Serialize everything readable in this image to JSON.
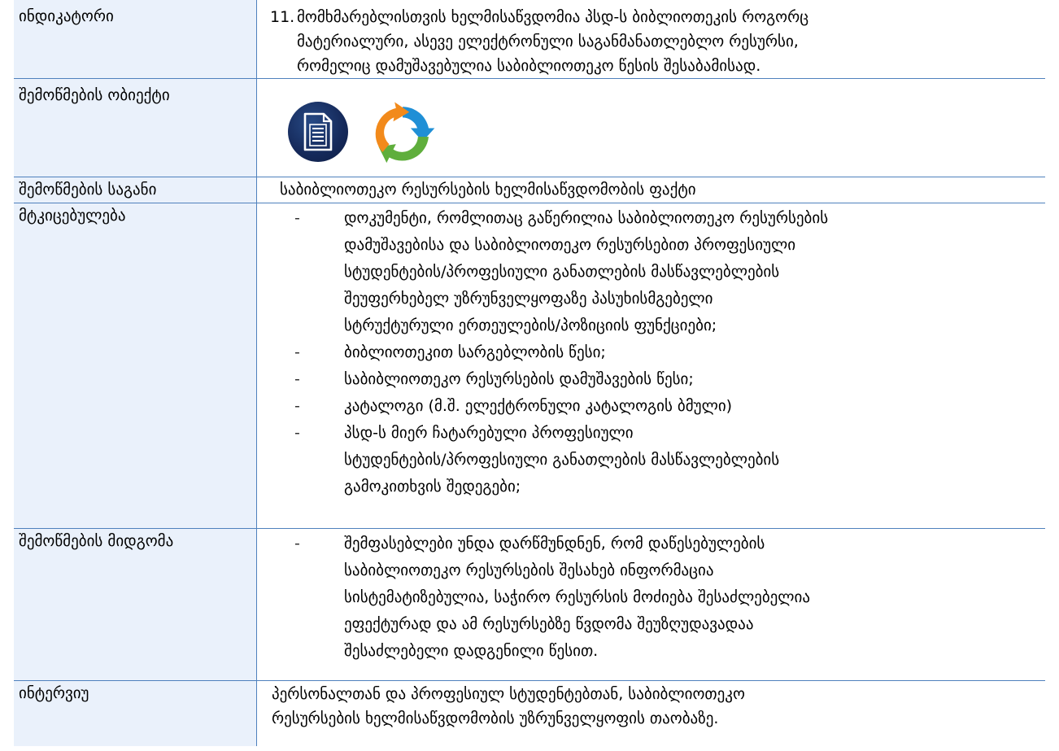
{
  "rows": {
    "indicator": {
      "label": "ინდიკატორი",
      "number": "11.",
      "lines": [
        "მომხმარებლისთვის ხელმისაწვდომია პსდ-ს ბიბლიოთეკის როგორც",
        "მატერიალური, ასევე ელექტრონული საგანმანათლებლო რესურსი,",
        "რომელიც დამუშავებულია საბიბლიოთეკო წესის შესაბამისად."
      ]
    },
    "object": {
      "label": "შემოწმების ობიექტი",
      "icons": [
        "document-icon",
        "refresh-cycle-icon"
      ],
      "colors": {
        "doc_circle": "#15295a",
        "cycle_blue": "#1f8fd6",
        "cycle_orange": "#f28a1b",
        "cycle_green": "#5fae3c"
      }
    },
    "subject": {
      "label": "შემოწმების საგანი",
      "text": "საბიბლიოთეკო რესურსების ხელმისაწვდომობის ფაქტი"
    },
    "evidence": {
      "label": "მტკიცებულება",
      "dash": "-",
      "items": [
        [
          "დოკუმენტი, რომლითაც გაწერილია საბიბლიოთეკო რესურსების",
          "დამუშავებისა და საბიბლიოთეკო რესურსებით პროფესიული",
          "სტუდენტების/პროფესიული განათლების მასწავლებლების",
          "შეუფერხებელ უზრუნველყოფაზე პასუხისმგებელი",
          "სტრუქტურული ერთეულების/პოზიციის ფუნქციები;"
        ],
        [
          "ბიბლიოთეკით სარგებლობის წესი;"
        ],
        [
          "საბიბლიოთეკო რესურსების დამუშავების წესი;"
        ],
        [
          "კატალოგი (მ.შ. ელექტრონული კატალოგის ბმული)"
        ],
        [
          "პსდ-ს მიერ ჩატარებული პროფესიული",
          "სტუდენტების/პროფესიული განათლების მასწავლებლების",
          "გამოკითხვის შედეგები;"
        ]
      ]
    },
    "approach": {
      "label": "შემოწმების მიდგომა",
      "dash": "-",
      "items": [
        [
          "შემფასებლები უნდა დარწმუნდნენ, რომ დაწესებულების",
          "საბიბლიოთეკო რესურსების შესახებ ინფორმაცია",
          "სისტემატიზებულია, საჭირო რესურსის მოძიება შესაძლებელია",
          "ეფექტურად და ამ რესურსებზე წვდომა შეუზღუდავადაა",
          "შესაძლებელი დადგენილი წესით."
        ]
      ]
    },
    "interview": {
      "label": "ინტერვიუ",
      "lines": [
        "პერსონალთან და პროფესიულ სტუდენტებთან, საბიბლიოთეკო",
        "რესურსების ხელმისაწვდომობის უზრუნველყოფის თაობაზე."
      ]
    }
  }
}
